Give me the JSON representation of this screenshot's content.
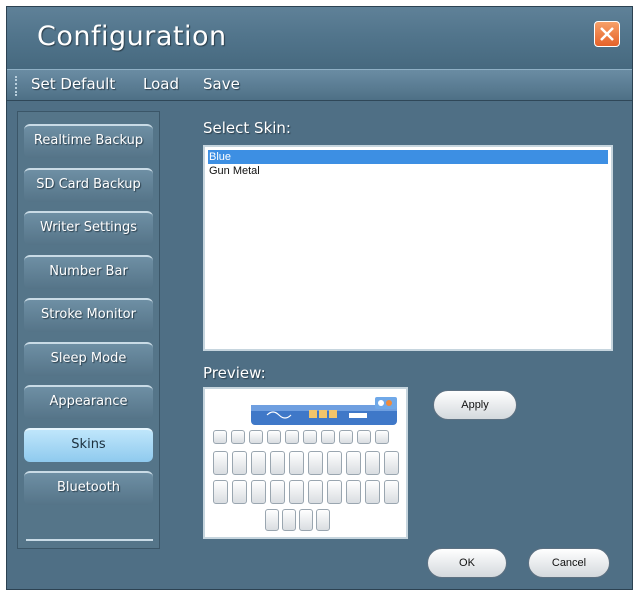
{
  "window": {
    "title": "Configuration"
  },
  "menu": {
    "items": [
      {
        "label": "Set Default"
      },
      {
        "label": "Load"
      },
      {
        "label": "Save"
      }
    ]
  },
  "sidebar": {
    "items": [
      {
        "label": "Realtime Backup"
      },
      {
        "label": "SD Card Backup"
      },
      {
        "label": "Writer Settings"
      },
      {
        "label": "Number Bar"
      },
      {
        "label": "Stroke Monitor"
      },
      {
        "label": "Sleep Mode"
      },
      {
        "label": "Appearance"
      },
      {
        "label": "Skins",
        "active": true
      },
      {
        "label": "Bluetooth"
      }
    ]
  },
  "skins": {
    "label": "Select Skin:",
    "options": [
      "Blue",
      "Gun Metal"
    ],
    "selected": "Blue"
  },
  "preview": {
    "label": "Preview:"
  },
  "buttons": {
    "apply": "Apply",
    "ok": "OK",
    "cancel": "Cancel"
  },
  "colors": {
    "window_bg": "#4f6f85",
    "active_tab": "#a6d8f5",
    "selection": "#3d8fe3",
    "close_button": "#e5622a"
  }
}
